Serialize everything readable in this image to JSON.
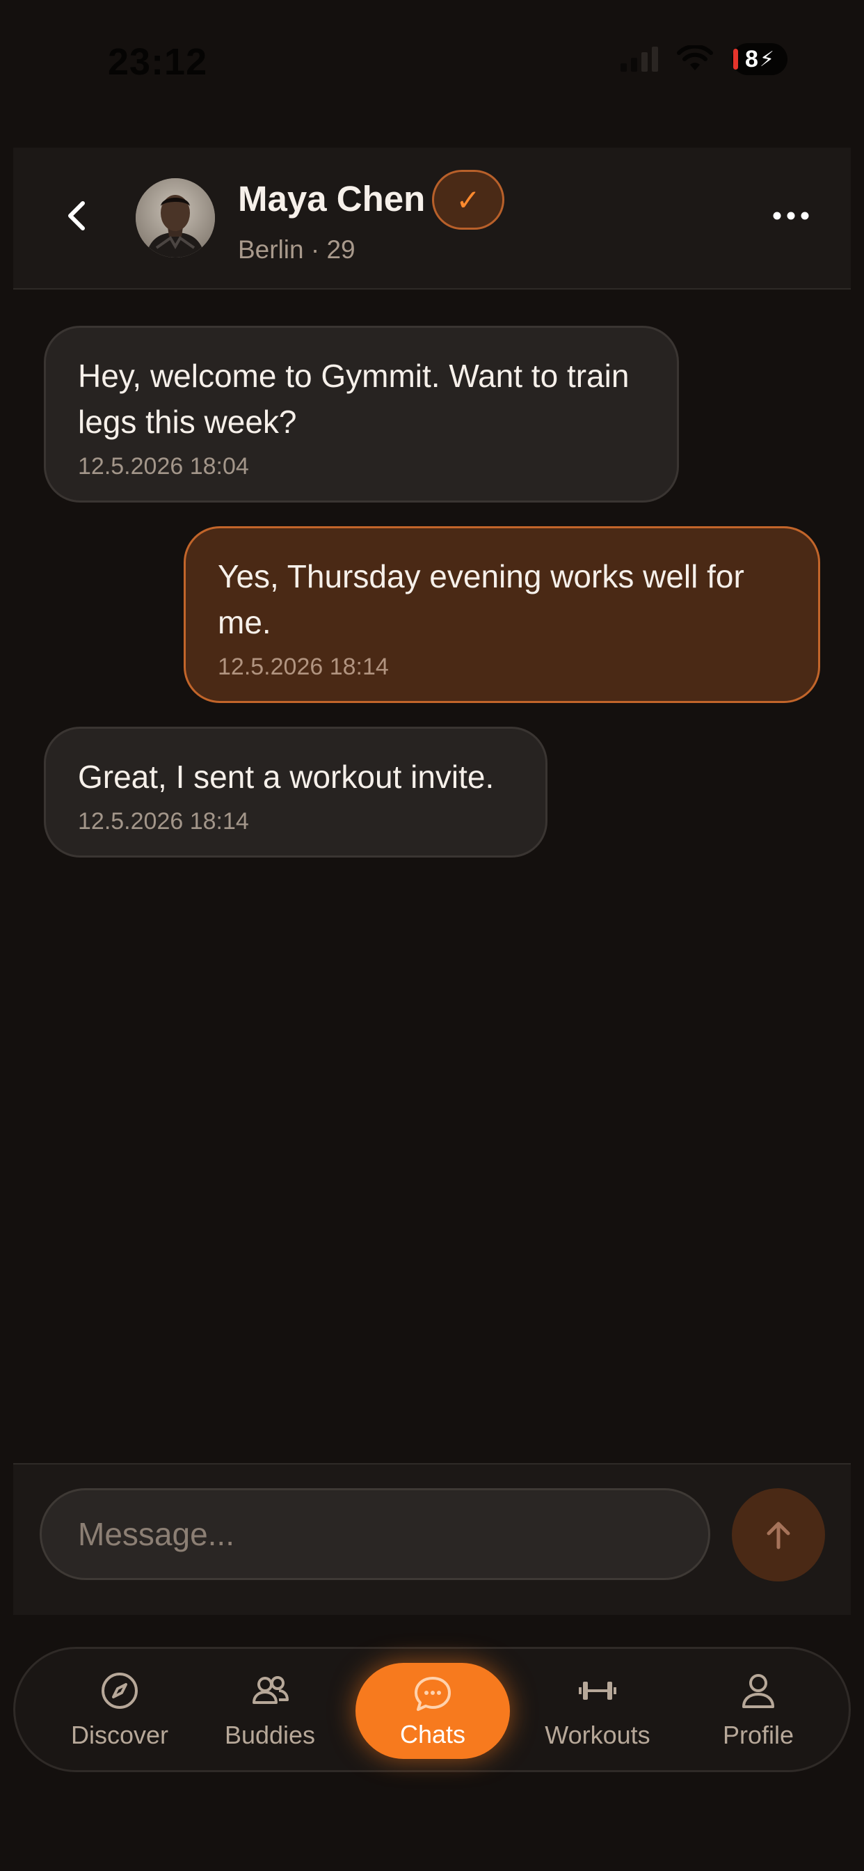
{
  "status_bar": {
    "time": "23:12",
    "battery": "8"
  },
  "header": {
    "contact_name": "Maya Chen",
    "verified_mark": "✓",
    "meta": "Berlin · 29"
  },
  "messages": [
    {
      "direction": "in",
      "text": "Hey, welcome to Gymmit. Want to train legs this week?",
      "time": "12.5.2026 18:04"
    },
    {
      "direction": "out",
      "text": "Yes, Thursday evening works well for me.",
      "time": "12.5.2026 18:14"
    },
    {
      "direction": "in",
      "text": "Great, I sent a workout invite.",
      "time": "12.5.2026 18:14"
    }
  ],
  "composer": {
    "placeholder": "Message..."
  },
  "nav": {
    "items": [
      {
        "label": "Discover",
        "icon": "compass-icon",
        "active": false
      },
      {
        "label": "Buddies",
        "icon": "users-icon",
        "active": false
      },
      {
        "label": "Chats",
        "icon": "chat-bubble-icon",
        "active": true
      },
      {
        "label": "Workouts",
        "icon": "dumbbell-icon",
        "active": false
      },
      {
        "label": "Profile",
        "icon": "person-icon",
        "active": false
      }
    ]
  },
  "colors": {
    "background": "#14100e",
    "accent": "#f77a1e",
    "outgoing_bubble": "#4a2915",
    "incoming_bubble": "#272321"
  }
}
